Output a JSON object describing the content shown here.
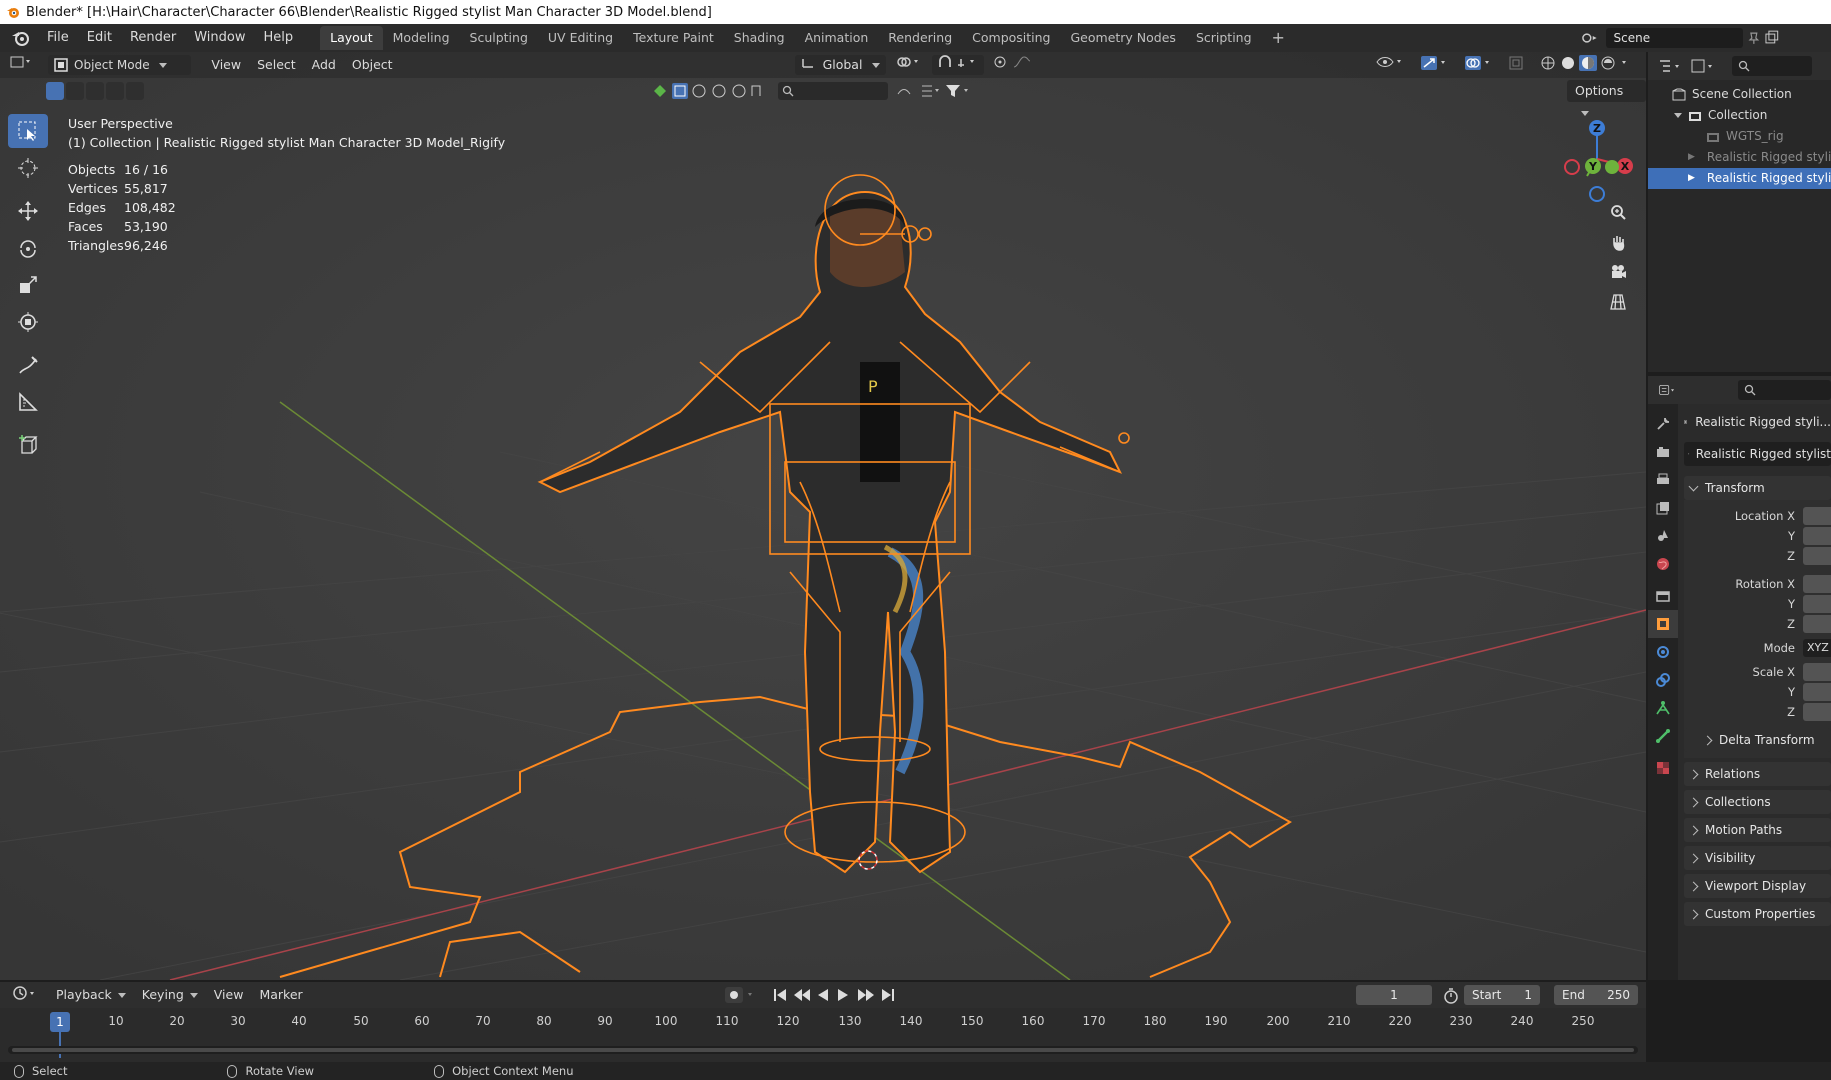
{
  "window": {
    "title": "Blender* [H:\\Hair\\Character\\Character 66\\Blender\\Realistic Rigged stylist Man Character 3D Model.blend]"
  },
  "menu": {
    "items": [
      "File",
      "Edit",
      "Render",
      "Window",
      "Help"
    ]
  },
  "workspaces": {
    "tabs": [
      "Layout",
      "Modeling",
      "Sculpting",
      "UV Editing",
      "Texture Paint",
      "Shading",
      "Animation",
      "Rendering",
      "Compositing",
      "Geometry Nodes",
      "Scripting"
    ],
    "active": "Layout",
    "add_icon": "plus-icon"
  },
  "scene": {
    "name": "Scene"
  },
  "viewport": {
    "mode": "Object Mode",
    "menus": [
      "View",
      "Select",
      "Add",
      "Object"
    ],
    "orientation": "Global",
    "options_label": "Options",
    "perspective": "User Perspective",
    "collection_line": "(1) Collection | Realistic Rigged stylist Man Character 3D Model_Rigify",
    "stats": [
      {
        "label": "Objects",
        "value": "16 / 16"
      },
      {
        "label": "Vertices",
        "value": "55,817"
      },
      {
        "label": "Edges",
        "value": "108,482"
      },
      {
        "label": "Faces",
        "value": "53,190"
      },
      {
        "label": "Triangles",
        "value": "96,246"
      }
    ],
    "gizmo": {
      "x": "X",
      "y": "Y",
      "z": "Z"
    },
    "colors": {
      "bg": "#3b3b3b",
      "selection": "#ff8a1f",
      "axis_x": "#c9464f",
      "axis_y": "#7aa33a",
      "accent": "#4772b3"
    }
  },
  "outliner": {
    "rows": [
      {
        "label": "Scene Collection",
        "indent": 0,
        "state": "normal"
      },
      {
        "label": "Collection",
        "indent": 1,
        "state": "normal"
      },
      {
        "label": "WGTS_rig",
        "indent": 2,
        "state": "dim"
      },
      {
        "label": "Realistic Rigged stylist",
        "indent": 2,
        "state": "dim"
      },
      {
        "label": "Realistic Rigged stylist",
        "indent": 2,
        "state": "selected"
      }
    ]
  },
  "properties": {
    "object_name": "Realistic Rigged styli...",
    "data_name": "Realistic Rigged stylist",
    "transform": {
      "title": "Transform",
      "location": [
        "Location X",
        "Y",
        "Z"
      ],
      "rotation": [
        "Rotation X",
        "Y",
        "Z"
      ],
      "mode_label": "Mode",
      "mode_value": "XYZ",
      "scale": [
        "Scale X",
        "Y",
        "Z"
      ],
      "delta": "Delta Transform"
    },
    "panels": [
      "Relations",
      "Collections",
      "Motion Paths",
      "Visibility",
      "Viewport Display",
      "Custom Properties"
    ]
  },
  "timeline": {
    "menus": [
      "Playback",
      "Keying",
      "View",
      "Marker"
    ],
    "current_frame": "1",
    "start_label": "Start",
    "start_value": "1",
    "end_label": "End",
    "end_value": "250",
    "ticks": [
      "10",
      "20",
      "30",
      "40",
      "50",
      "60",
      "70",
      "80",
      "90",
      "100",
      "110",
      "120",
      "130",
      "140",
      "150",
      "160",
      "170",
      "180",
      "190",
      "200",
      "210",
      "220",
      "230",
      "240",
      "250"
    ]
  },
  "statusbar": {
    "items": [
      "Select",
      "Rotate View",
      "Object Context Menu"
    ]
  }
}
